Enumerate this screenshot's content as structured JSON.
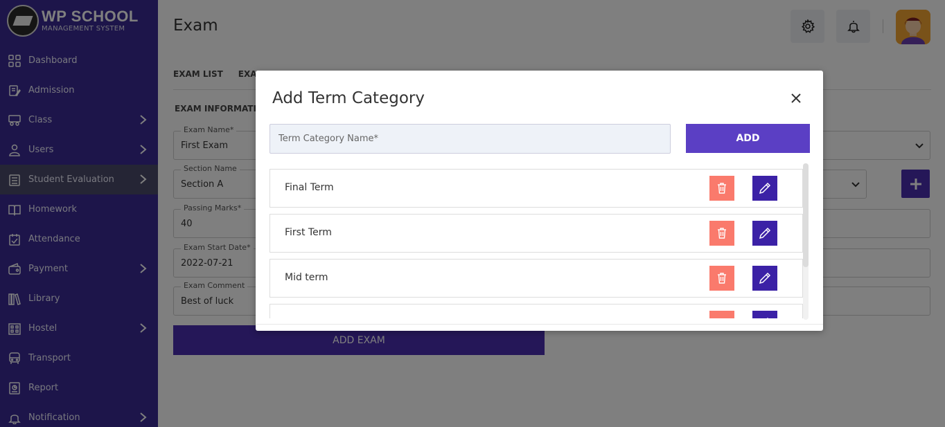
{
  "logo": {
    "title": "WP SCHOOL",
    "subtitle": "MANAGEMENT SYSTEM"
  },
  "sidebar": {
    "items": [
      {
        "label": "Dashboard",
        "icon": "dashboard-icon",
        "chevron": false
      },
      {
        "label": "Admission",
        "icon": "admission-icon",
        "chevron": false
      },
      {
        "label": "Class",
        "icon": "class-icon",
        "chevron": true
      },
      {
        "label": "Users",
        "icon": "user-icon",
        "chevron": true
      },
      {
        "label": "Student Evaluation",
        "icon": "evaluation-icon",
        "chevron": true,
        "active": true
      },
      {
        "label": "Homework",
        "icon": "homework-icon",
        "chevron": false
      },
      {
        "label": "Attendance",
        "icon": "attendance-icon",
        "chevron": false
      },
      {
        "label": "Payment",
        "icon": "payment-icon",
        "chevron": true
      },
      {
        "label": "Library",
        "icon": "library-icon",
        "chevron": false
      },
      {
        "label": "Hostel",
        "icon": "hostel-icon",
        "chevron": true
      },
      {
        "label": "Transport",
        "icon": "transport-icon",
        "chevron": false
      },
      {
        "label": "Report",
        "icon": "report-icon",
        "chevron": false
      },
      {
        "label": "Notification",
        "icon": "notification-icon",
        "chevron": true
      }
    ]
  },
  "header": {
    "title": "Exam"
  },
  "tabs": [
    "EXAM LIST",
    "EXAM"
  ],
  "section_title": "EXAM INFORMATION",
  "form": {
    "exam_name": {
      "label": "Exam Name*",
      "value": "First Exam"
    },
    "section_name": {
      "label": "Section Name",
      "value": "Section A"
    },
    "passing_marks": {
      "label": "Passing Marks*",
      "value": "40"
    },
    "exam_start_date": {
      "label": "Exam Start Date*",
      "value": "2022-07-21"
    },
    "exam_comment": {
      "label": "Exam Comment",
      "value": "Best of luck"
    },
    "submit_label": "ADD EXAM"
  },
  "modal": {
    "title": "Add Term Category",
    "input_placeholder": "Term Category Name*",
    "add_label": "ADD",
    "terms": [
      "Final Term",
      "First Term",
      "Mid term",
      ""
    ]
  },
  "colors": {
    "sidebar_bg": "#3b2b94",
    "accent": "#4a2fb0",
    "delete": "#fa7a6c",
    "edit": "#3b21a6"
  }
}
